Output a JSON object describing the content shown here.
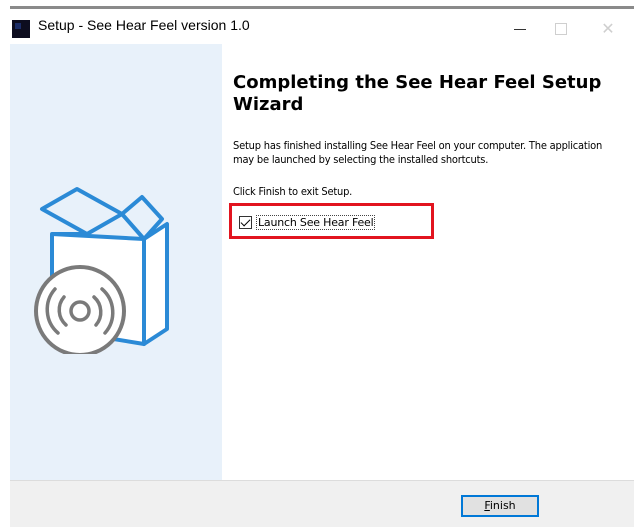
{
  "window": {
    "title": "Setup - See Hear Feel version 1.0",
    "controls": {
      "minimize_icon": "minimize-icon",
      "maximize_icon": "maximize-icon",
      "close": "✕"
    }
  },
  "wizard": {
    "heading": "Completing the See Hear Feel Setup Wizard",
    "message": "Setup has finished installing See Hear Feel on your computer. The application may be launched by selecting the installed shortcuts.",
    "instruction": "Click Finish to exit Setup.",
    "launch_checkbox": {
      "label": "Launch See Hear Feel",
      "checked": true
    }
  },
  "footer": {
    "finish_mnemonic": "F",
    "finish_rest": "inish"
  },
  "colors": {
    "highlight": "#e2141f",
    "panel": "#e8f1fa",
    "box_stroke": "#2b8ad6",
    "disc": "#7a7a7a",
    "button_border": "#0078d7"
  }
}
